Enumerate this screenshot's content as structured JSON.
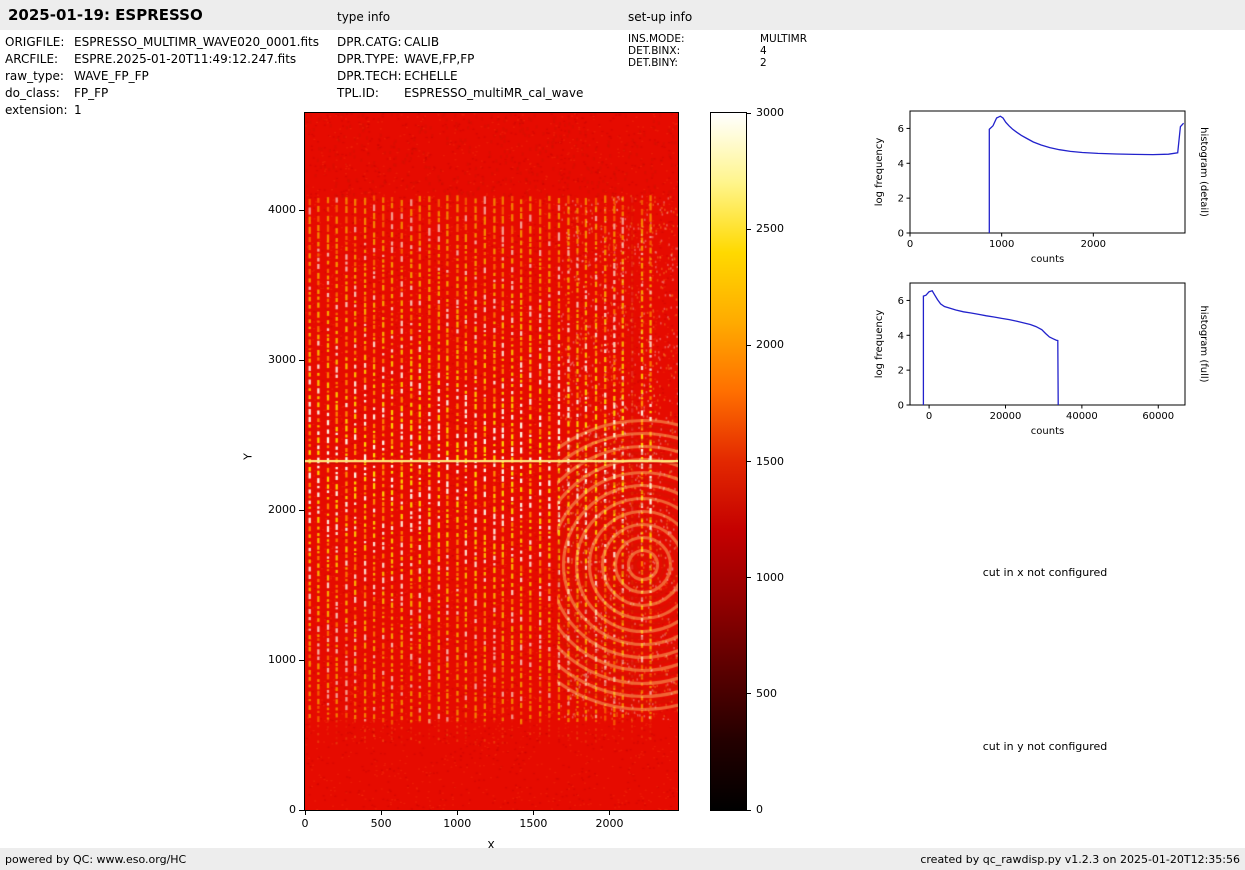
{
  "header": {
    "title": "2025-01-19: ESPRESSO",
    "type_info_label": "type info",
    "setup_info_label": "set-up info"
  },
  "file_info": [
    {
      "key": "ORIGFILE:",
      "value": "ESPRESSO_MULTIMR_WAVE020_0001.fits"
    },
    {
      "key": "ARCFILE:",
      "value": "ESPRE.2025-01-20T11:49:12.247.fits"
    },
    {
      "key": "raw_type:",
      "value": "WAVE_FP_FP"
    },
    {
      "key": "do_class:",
      "value": "FP_FP"
    },
    {
      "key": "extension:",
      "value": "1"
    }
  ],
  "type_info": [
    {
      "key": "DPR.CATG:",
      "value": "CALIB"
    },
    {
      "key": "DPR.TYPE:",
      "value": "WAVE,FP,FP"
    },
    {
      "key": "DPR.TECH:",
      "value": "ECHELLE"
    },
    {
      "key": "TPL.ID:",
      "value": "ESPRESSO_multiMR_cal_wave"
    }
  ],
  "setup_info": [
    {
      "key": "INS.MODE:",
      "value": "MULTIMR"
    },
    {
      "key": "DET.BINX:",
      "value": "4"
    },
    {
      "key": "DET.BINY:",
      "value": "2"
    }
  ],
  "messages": {
    "cut_x": "cut in x not configured",
    "cut_y": "cut in y not configured"
  },
  "footer": {
    "left": "powered by QC: www.eso.org/HC",
    "right": "created by qc_rawdisp.py v1.2.3 on 2025-01-20T12:35:56"
  },
  "chart_data": [
    {
      "id": "raw_image",
      "type": "heatmap",
      "xlabel": "X",
      "ylabel": "Y",
      "xlim": [
        0,
        2450
      ],
      "ylim": [
        0,
        4650
      ],
      "xticks": [
        0,
        500,
        1000,
        1500,
        2000
      ],
      "yticks": [
        0,
        1000,
        2000,
        3000,
        4000
      ],
      "colormap": "black-red-orange-yellow-white (hot)",
      "colorbar": {
        "min": 0,
        "max": 3000,
        "ticks": [
          0,
          500,
          1000,
          1500,
          2000,
          2500,
          3000
        ],
        "gradient": [
          "#000000",
          "#240000",
          "#5a0000",
          "#930000",
          "#c40000",
          "#e32800",
          "#ff6f00",
          "#ffab00",
          "#ffd900",
          "#fff58c",
          "#ffffff"
        ]
      },
      "description": "ESPRESSO raw Fabry-Perot wave calibration frame: red background with ~38 bright dashed vertical echelle-order stripes between y=500 and y=4100, a bright horizontal line at y=2330, a darker vertical column near x=2130, and circular interference fringes near x=2250, y=1600"
    },
    {
      "id": "histogram_detail",
      "type": "line",
      "right_label": "histogram (detail)",
      "xlabel": "counts",
      "ylabel": "log frequency",
      "xlim": [
        0,
        3000
      ],
      "ylim": [
        0,
        7
      ],
      "xticks": [
        0,
        1000,
        2000
      ],
      "yticks": [
        0,
        2,
        4,
        6
      ],
      "line_color": "#2222cc",
      "points": [
        [
          865,
          0
        ],
        [
          865,
          5.95
        ],
        [
          905,
          6.15
        ],
        [
          945,
          6.6
        ],
        [
          985,
          6.7
        ],
        [
          1015,
          6.6
        ],
        [
          1045,
          6.35
        ],
        [
          1080,
          6.15
        ],
        [
          1120,
          5.95
        ],
        [
          1165,
          5.78
        ],
        [
          1215,
          5.6
        ],
        [
          1275,
          5.42
        ],
        [
          1345,
          5.22
        ],
        [
          1430,
          5.05
        ],
        [
          1525,
          4.9
        ],
        [
          1630,
          4.78
        ],
        [
          1750,
          4.68
        ],
        [
          1880,
          4.62
        ],
        [
          2050,
          4.57
        ],
        [
          2250,
          4.53
        ],
        [
          2450,
          4.51
        ],
        [
          2650,
          4.5
        ],
        [
          2820,
          4.52
        ],
        [
          2920,
          4.6
        ],
        [
          2950,
          6.1
        ],
        [
          2985,
          6.3
        ]
      ]
    },
    {
      "id": "histogram_full",
      "type": "line",
      "right_label": "histogram (full)",
      "xlabel": "counts",
      "ylabel": "log frequency",
      "xlim": [
        -5000,
        67000
      ],
      "ylim": [
        0,
        7
      ],
      "xticks": [
        0,
        20000,
        40000,
        60000
      ],
      "yticks": [
        0,
        2,
        4,
        6
      ],
      "line_color": "#2222cc",
      "points": [
        [
          -1500,
          0
        ],
        [
          -1500,
          6.25
        ],
        [
          -800,
          6.3
        ],
        [
          0,
          6.5
        ],
        [
          800,
          6.55
        ],
        [
          1500,
          6.3
        ],
        [
          2200,
          6.05
        ],
        [
          3000,
          5.8
        ],
        [
          4000,
          5.65
        ],
        [
          5500,
          5.55
        ],
        [
          7000,
          5.45
        ],
        [
          9000,
          5.35
        ],
        [
          11000,
          5.28
        ],
        [
          13000,
          5.2
        ],
        [
          15000,
          5.12
        ],
        [
          17000,
          5.05
        ],
        [
          19000,
          4.97
        ],
        [
          21000,
          4.9
        ],
        [
          23000,
          4.8
        ],
        [
          25000,
          4.7
        ],
        [
          26500,
          4.62
        ],
        [
          28000,
          4.5
        ],
        [
          29500,
          4.32
        ],
        [
          30500,
          4.1
        ],
        [
          31500,
          3.9
        ],
        [
          32500,
          3.8
        ],
        [
          33300,
          3.72
        ],
        [
          33700,
          3.7
        ],
        [
          33800,
          0
        ]
      ]
    }
  ]
}
